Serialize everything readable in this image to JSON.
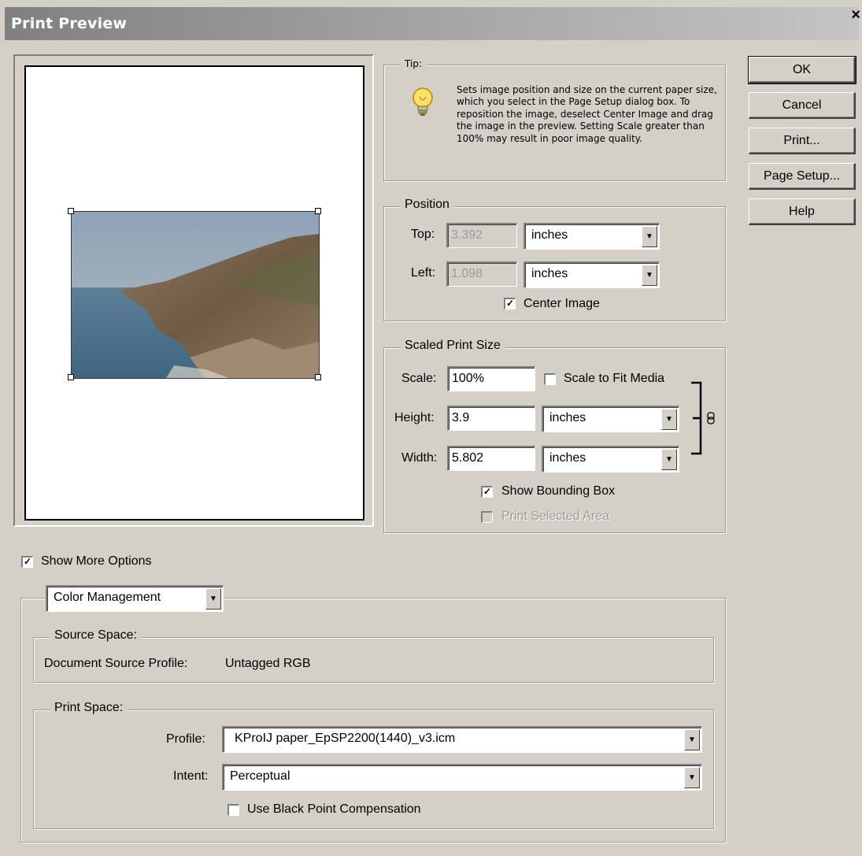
{
  "window": {
    "title": "Print Preview",
    "close_label": "×"
  },
  "buttons": {
    "ok": "OK",
    "cancel": "Cancel",
    "print": "Print...",
    "page_setup": "Page Setup...",
    "help": "Help"
  },
  "tip": {
    "label": "Tip:",
    "text": "Sets image position and size on the current paper  size, which you select in the Page Setup dialog box. To reposition the image,  deselect Center Image and drag the image in the preview. Setting Scale greater  than 100% may result in poor image quality.",
    "icon": "lightbulb-icon"
  },
  "position": {
    "legend": "Position",
    "top_label": "Top:",
    "top_value": "3.392",
    "top_unit": "inches",
    "left_label": "Left:",
    "left_value": "1.098",
    "left_unit": "inches",
    "center_image_label": "Center Image",
    "center_image_checked": true
  },
  "scaled": {
    "legend": "Scaled Print Size",
    "scale_label": "Scale:",
    "scale_value": "100%",
    "fit_media_label": "Scale to Fit Media",
    "fit_media_checked": false,
    "height_label": "Height:",
    "height_value": "3.9",
    "height_unit": "inches",
    "width_label": "Width:",
    "width_value": "5.802",
    "width_unit": "inches",
    "bounding_box_label": "Show Bounding Box",
    "bounding_box_checked": true,
    "print_selected_label": "Print Selected Area",
    "print_selected_checked": false
  },
  "more_options": {
    "label": "Show More Options",
    "checked": true
  },
  "color_mgmt": {
    "dropdown_value": "Color Management",
    "source_legend": "Source Space:",
    "doc_profile_label": "Document Source Profile:",
    "doc_profile_value": "Untagged RGB",
    "print_legend": "Print Space:",
    "profile_label": "Profile:",
    "profile_value": "KProIJ paper_EpSP2200(1440)_v3.icm",
    "intent_label": "Intent:",
    "intent_value": "Perceptual",
    "bpc_label": "Use Black Point Compensation",
    "bpc_checked": false
  }
}
